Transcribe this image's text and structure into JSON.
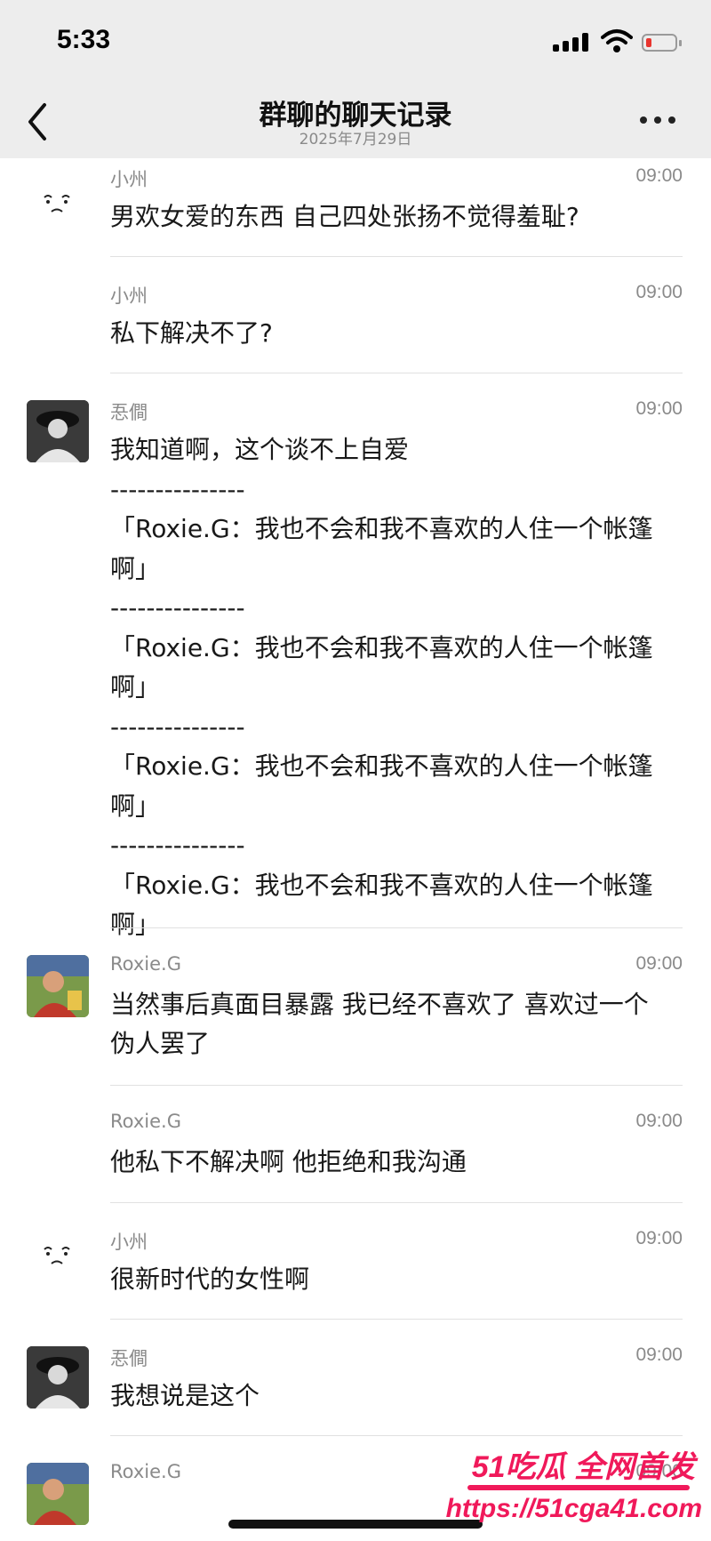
{
  "status_bar": {
    "time": "5:33"
  },
  "nav": {
    "title": "群聊的聊天记录",
    "subtitle": "2025年7月29日"
  },
  "messages": [
    {
      "sender": "小州",
      "time": "09:00",
      "text": "男欢女爱的东西 自己四处张扬不觉得羞耻?",
      "avatar": "face-emoji",
      "show_avatar": true
    },
    {
      "sender": "小州",
      "time": "09:00",
      "text": "私下解决不了?",
      "avatar": "none",
      "show_avatar": false
    },
    {
      "sender": "忢僴",
      "time": "09:00",
      "text": "我知道啊，这个谈不上自爱\n---------------\n「Roxie.G：我也不会和我不喜欢的人住一个帐篷啊」\n---------------\n「Roxie.G：我也不会和我不喜欢的人住一个帐篷啊」\n---------------\n「Roxie.G：我也不会和我不喜欢的人住一个帐篷啊」\n---------------\n「Roxie.G：我也不会和我不喜欢的人住一个帐篷啊」",
      "avatar": "dark-photo",
      "show_avatar": true
    },
    {
      "sender": "Roxie.G",
      "time": "09:00",
      "text": "当然事后真面目暴露 我已经不喜欢了 喜欢过一个伪人罢了",
      "avatar": "colorful-photo",
      "show_avatar": true
    },
    {
      "sender": "Roxie.G",
      "time": "09:00",
      "text": "他私下不解决啊 他拒绝和我沟通",
      "avatar": "none",
      "show_avatar": false
    },
    {
      "sender": "小州",
      "time": "09:00",
      "text": "很新时代的女性啊",
      "avatar": "face-emoji",
      "show_avatar": true
    },
    {
      "sender": "忢僴",
      "time": "09:00",
      "text": "我想说是这个",
      "avatar": "dark-photo",
      "show_avatar": true
    },
    {
      "sender": "Roxie.G",
      "time": "09:00",
      "text": "",
      "avatar": "colorful-photo",
      "show_avatar": true
    }
  ],
  "watermark": {
    "line1": "51吃瓜 全网首发",
    "line2": "https://51cga41.com"
  },
  "colors": {
    "topbar": "#ededed",
    "accent_watermark": "#f0195a",
    "battery_low": "#e8352f"
  },
  "icons": [
    "signal-icon",
    "wifi-icon",
    "battery-icon",
    "back-chevron-icon",
    "more-dots-icon"
  ]
}
